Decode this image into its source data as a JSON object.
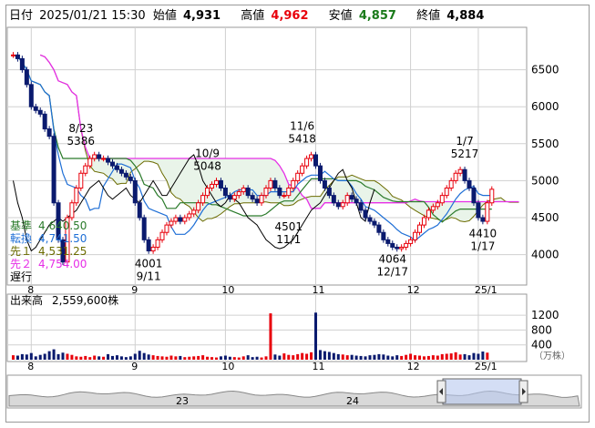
{
  "header": {
    "date_label": "日付",
    "datetime": "2025/01/21 15:30",
    "open_label": "始値",
    "open_value": "4,931",
    "high_label": "高値",
    "high_value": "4,962",
    "low_label": "安値",
    "low_value": "4,857",
    "close_label": "終値",
    "close_value": "4,884"
  },
  "colors": {
    "up": "#e8000b",
    "down": "#0a1a6e",
    "kijun": "#2a7a2a",
    "tenkan": "#1f6fd6",
    "senko1": "#6b6b00",
    "senko2": "#e62ee6",
    "chikou": "#000000",
    "cloud": "#e9f4e9",
    "high_text": "#e8000b",
    "low_text": "#1a7a1a",
    "volume_up": "#e8000b",
    "volume_down": "#0a1a6e"
  },
  "legend": [
    {
      "label": "基準",
      "value": "4,640.50",
      "color": "#2a7a2a"
    },
    {
      "label": "転換",
      "value": "4,741.50",
      "color": "#1f6fd6"
    },
    {
      "label": "先１",
      "value": "4,531.25",
      "color": "#6b6b00"
    },
    {
      "label": "先２",
      "value": "4,754.00",
      "color": "#e62ee6"
    },
    {
      "label": "遅行",
      "value": "",
      "color": "#000000"
    }
  ],
  "volume_panel": {
    "label": "出来高",
    "value": "2,559,600株",
    "unit": "（万株）"
  },
  "navigator": {
    "year_labels": [
      "23",
      "24"
    ]
  },
  "chart_data": [
    {
      "type": "candlestick",
      "title": "",
      "ylim": [
        3650,
        7000
      ],
      "y_ticks": [
        "4000",
        "4500",
        "5000",
        "5500",
        "6000",
        "6500"
      ],
      "x_labels": [
        "8",
        "9",
        "10",
        "11",
        "12",
        "25/1"
      ],
      "annotations": [
        {
          "date": "8/23",
          "price": "5386",
          "position": "above"
        },
        {
          "date": "9/11",
          "price": "4001",
          "position": "below"
        },
        {
          "date": "10/9",
          "price": "5048",
          "position": "above"
        },
        {
          "date": "11/6",
          "price": "5418",
          "position": "above"
        },
        {
          "date": "11/1",
          "price": "4501",
          "position": "below"
        },
        {
          "date": "12/17",
          "price": "4064",
          "position": "below"
        },
        {
          "date": "1/7",
          "price": "5217",
          "position": "above"
        },
        {
          "date": "1/17",
          "price": "4410",
          "position": "below"
        }
      ],
      "close": [
        6700,
        6650,
        6500,
        6300,
        6000,
        5950,
        5900,
        5700,
        5600,
        4700,
        4200,
        3900,
        4500,
        4700,
        4900,
        5100,
        5200,
        5300,
        5350,
        5300,
        5300,
        5250,
        5200,
        5150,
        5100,
        5050,
        5000,
        4700,
        4500,
        4200,
        4050,
        4100,
        4200,
        4300,
        4400,
        4450,
        4500,
        4450,
        4500,
        4550,
        4600,
        4700,
        4800,
        4900,
        4950,
        5000,
        4900,
        4800,
        4750,
        4800,
        4850,
        4900,
        4800,
        4750,
        4700,
        4800,
        4900,
        5000,
        4900,
        4800,
        4800,
        4900,
        5000,
        5100,
        5200,
        5300,
        5350,
        5200,
        5000,
        4900,
        4800,
        4700,
        4650,
        4700,
        4800,
        4750,
        4700,
        4600,
        4500,
        4450,
        4400,
        4300,
        4200,
        4150,
        4100,
        4080,
        4100,
        4150,
        4200,
        4300,
        4400,
        4500,
        4600,
        4650,
        4700,
        4800,
        4900,
        5000,
        5100,
        5150,
        5000,
        4900,
        4700,
        4500,
        4450,
        4700,
        4884
      ],
      "volume_ranges": {
        "ylim": [
          0,
          1400
        ],
        "ticks": [
          "400",
          "800",
          "1200"
        ]
      },
      "volume": [
        120,
        110,
        150,
        140,
        180,
        90,
        130,
        160,
        230,
        280,
        150,
        190,
        160,
        130,
        90,
        80,
        100,
        70,
        110,
        90,
        80,
        150,
        100,
        120,
        90,
        70,
        90,
        160,
        240,
        180,
        140,
        120,
        100,
        90,
        80,
        110,
        90,
        100,
        70,
        80,
        90,
        100,
        120,
        80,
        70,
        60,
        90,
        110,
        80,
        70,
        60,
        90,
        120,
        70,
        80,
        60,
        90,
        1250,
        140,
        110,
        170,
        130,
        120,
        150,
        180,
        160,
        200,
        1270,
        260,
        230,
        210,
        180,
        150,
        140,
        120,
        130,
        110,
        100,
        90,
        120,
        130,
        150,
        140,
        110,
        90,
        120,
        100,
        130,
        160,
        120,
        110,
        90,
        100,
        120,
        110,
        150,
        160,
        170,
        200,
        140,
        150,
        120,
        180,
        160,
        220,
        190
      ]
    }
  ]
}
